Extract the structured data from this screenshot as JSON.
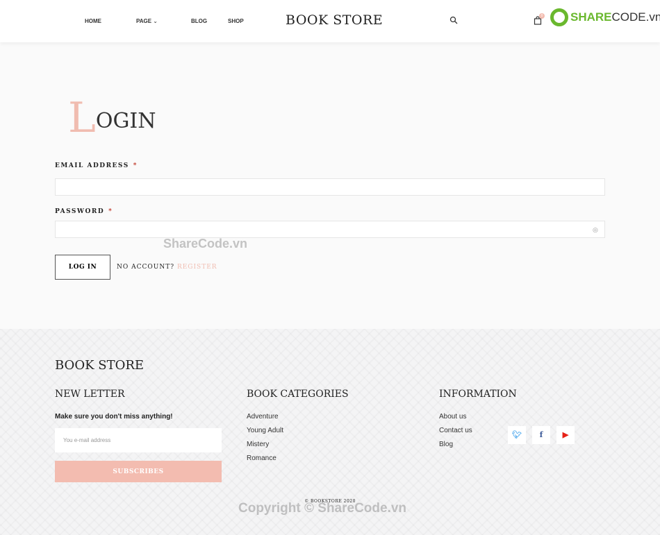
{
  "header": {
    "nav": [
      "HOME",
      "PAGE",
      "BLOG",
      "SHOP"
    ],
    "logo": "BOOK STORE",
    "cart_count": "0"
  },
  "watermark": {
    "logo": "SHARECODE.vn",
    "center": "ShareCode.vn",
    "bottom": "Copyright © ShareCode.vn"
  },
  "login": {
    "title_initial": "L",
    "title_rest": "OGIN",
    "email_label": "EMAIL ADDRESS",
    "password_label": "PASSWORD",
    "required": "*",
    "button": "LOG IN",
    "no_account": "NO ACCOUNT?",
    "register": "REGISTER"
  },
  "footer": {
    "logo": "BOOK STORE",
    "newsletter": {
      "title": "NEW LETTER",
      "subtitle": "Make sure you don't miss anything!",
      "placeholder": "You e-mail address",
      "button": "SUBSCRIBES"
    },
    "categories": {
      "title": "BOOK CATEGORIES",
      "items": [
        "Adventure",
        "Young Adult",
        "Mistery",
        "Romance"
      ]
    },
    "information": {
      "title": "INFORMATION",
      "items": [
        "About us",
        "Contact us",
        "Blog"
      ]
    },
    "social": [
      {
        "icon": "twitter-icon",
        "color": "#55acee"
      },
      {
        "icon": "facebook-icon",
        "color": "#3b5998"
      },
      {
        "icon": "youtube-icon",
        "color": "#e62117"
      }
    ],
    "copyright": "© BOOKSTORE 2020"
  },
  "colors": {
    "accent": "#f3bcb0"
  }
}
